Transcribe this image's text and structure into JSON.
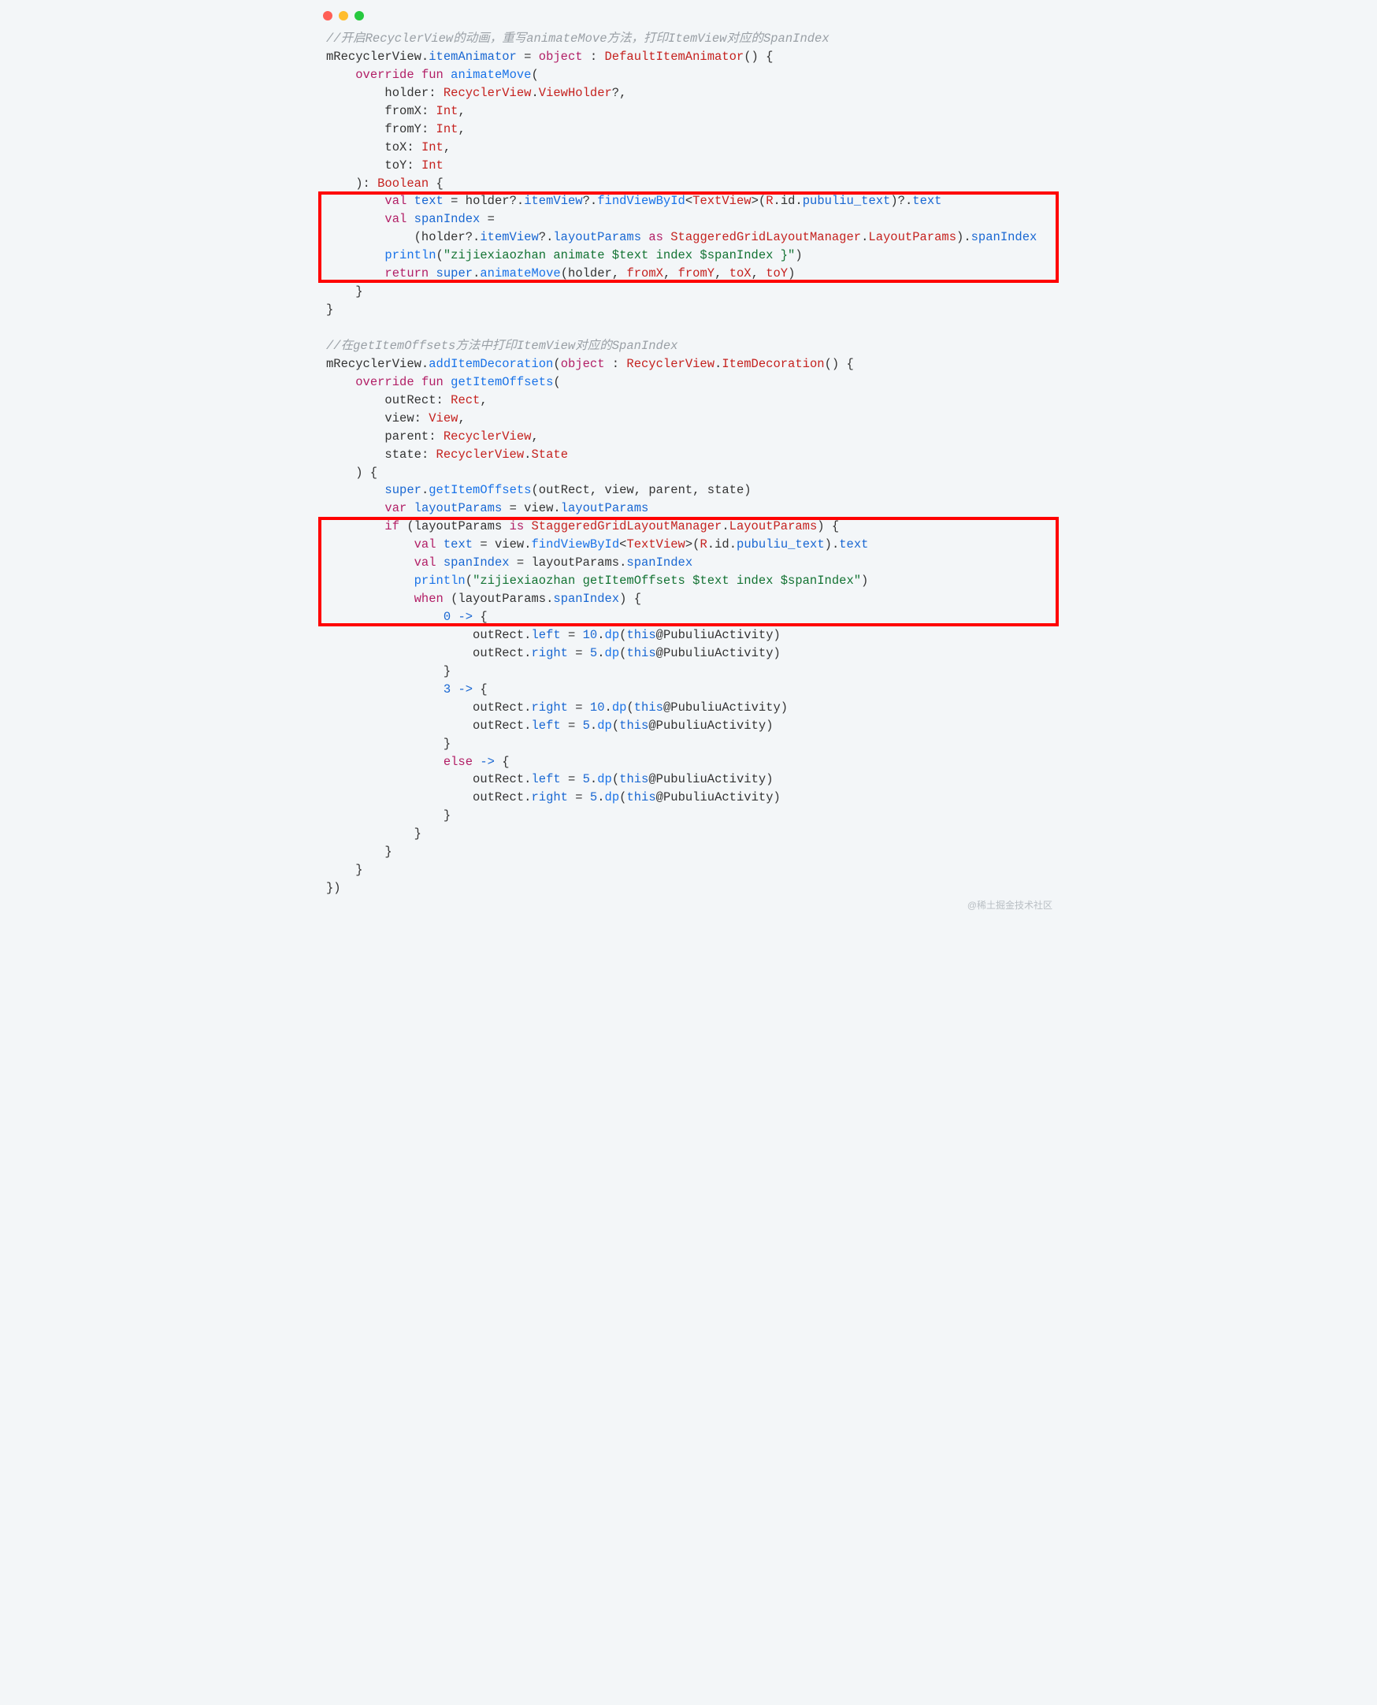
{
  "watermark": "@稀土掘金技术社区",
  "code": {
    "c01": "//开启RecyclerView的动画，重写animateMove方法，打印ItemView对应的SpanIndex",
    "l02a": "mRecyclerView",
    "l02b": "itemAnimator",
    "l02c": "object",
    "l02d": "DefaultItemAnimator",
    "l03a": "override",
    "l03b": "fun",
    "l03c": "animateMove",
    "l04a": "holder",
    "l04b": "RecyclerView",
    "l04c": "ViewHolder",
    "l05a": "fromX",
    "l05b": "Int",
    "l06a": "fromY",
    "l06b": "Int",
    "l07a": "toX",
    "l07b": "Int",
    "l08a": "toY",
    "l08b": "Int",
    "l09a": "Boolean",
    "l10a": "val",
    "l10b": "text",
    "l10c": "holder",
    "l10d": "itemView",
    "l10e": "findViewById",
    "l10f": "TextView",
    "l10g": "R",
    "l10h": "id",
    "l10i": "pubuliu_text",
    "l10j": "text",
    "l11a": "val",
    "l11b": "spanIndex",
    "l12a": "holder",
    "l12b": "itemView",
    "l12c": "layoutParams",
    "l12d": "as",
    "l12e": "StaggeredGridLayoutManager",
    "l12f": "LayoutParams",
    "l12g": "spanIndex",
    "l13a": "println",
    "l13b": "\"zijiexiaozhan animate $text index $spanIndex }\"",
    "l14a": "return",
    "l14b": "super",
    "l14c": "animateMove",
    "l14d": "holder",
    "l14e": "fromX",
    "l14f": "fromY",
    "l14g": "toX",
    "l14h": "toY",
    "c20": "//在getItemOffsets方法中打印ItemView对应的SpanIndex",
    "l21a": "mRecyclerView",
    "l21b": "addItemDecoration",
    "l21c": "object",
    "l21d": "RecyclerView",
    "l21e": "ItemDecoration",
    "l22a": "override",
    "l22b": "fun",
    "l22c": "getItemOffsets",
    "l23a": "outRect",
    "l23b": "Rect",
    "l24a": "view",
    "l24b": "View",
    "l25a": "parent",
    "l25b": "RecyclerView",
    "l26a": "state",
    "l26b": "RecyclerView",
    "l26c": "State",
    "l28a": "super",
    "l28b": "getItemOffsets",
    "l28c": "outRect",
    "l28d": "view",
    "l28e": "parent",
    "l28f": "state",
    "l29a": "var",
    "l29b": "layoutParams",
    "l29c": "view",
    "l29d": "layoutParams",
    "l30a": "if",
    "l30b": "layoutParams",
    "l30c": "is",
    "l30d": "StaggeredGridLayoutManager",
    "l30e": "LayoutParams",
    "l31a": "val",
    "l31b": "text",
    "l31c": "view",
    "l31d": "findViewById",
    "l31e": "TextView",
    "l31f": "R",
    "l31g": "id",
    "l31h": "pubuliu_text",
    "l31i": "text",
    "l32a": "val",
    "l32b": "spanIndex",
    "l32c": "layoutParams",
    "l32d": "spanIndex",
    "l33a": "println",
    "l33b": "\"zijiexiaozhan getItemOffsets $text index $spanIndex\"",
    "l34a": "when",
    "l34b": "layoutParams",
    "l34c": "spanIndex",
    "l35a": "0",
    "l36a": "outRect",
    "l36b": "left",
    "l36c": "10",
    "l36d": "dp",
    "l36e": "this",
    "l36f": "PubuliuActivity",
    "l37a": "outRect",
    "l37b": "right",
    "l37c": "5",
    "l37d": "dp",
    "l37e": "this",
    "l37f": "PubuliuActivity",
    "l39a": "3",
    "l40a": "outRect",
    "l40b": "right",
    "l40c": "10",
    "l40d": "dp",
    "l40e": "this",
    "l40f": "PubuliuActivity",
    "l41a": "outRect",
    "l41b": "left",
    "l41c": "5",
    "l41d": "dp",
    "l41e": "this",
    "l41f": "PubuliuActivity",
    "l43a": "else",
    "l44a": "outRect",
    "l44b": "left",
    "l44c": "5",
    "l44d": "dp",
    "l44e": "this",
    "l44f": "PubuliuActivity",
    "l45a": "outRect",
    "l45b": "right",
    "l45c": "5",
    "l45d": "dp",
    "l45e": "this",
    "l45f": "PubuliuActivity"
  }
}
